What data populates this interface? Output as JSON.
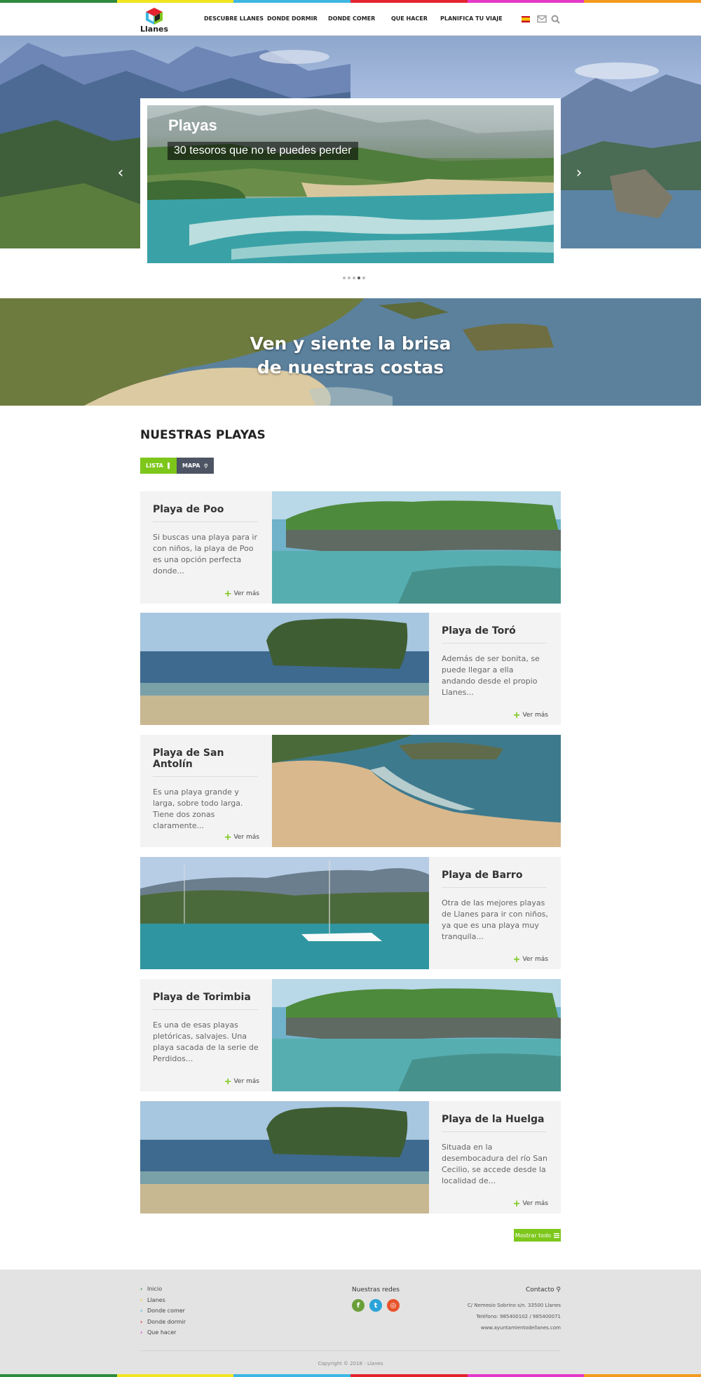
{
  "brand": {
    "logo_text": "Llanes"
  },
  "nav": {
    "items": [
      "DESCUBRE LLANES",
      "DONDE DORMIR",
      "DONDE COMER",
      "QUE HACER",
      "PLANIFICA TU VIAJE"
    ]
  },
  "colors": {
    "accent": "#7dc71b",
    "dark_button": "#4d5463",
    "bar": [
      "#2e8b3e",
      "#f2e51f",
      "#3cb6e3",
      "#e3232d",
      "#e438c8",
      "#f39a1e"
    ]
  },
  "slider": {
    "title": "Playas",
    "subtitle": "30 tesoros que no te puedes perder",
    "dots": 5,
    "active_dot": 4
  },
  "banner": {
    "line1": "Ven y siente la brisa",
    "line2": "de nuestras costas"
  },
  "section": {
    "title": "NUESTRAS PLAYAS",
    "list_label": "LISTA",
    "map_label": "MAPA"
  },
  "beaches": [
    {
      "name": "Playa de Poo",
      "text": "Si buscas una playa para ir con niños, la playa de Poo es una opción perfecta donde...",
      "more": "Ver más"
    },
    {
      "name": "Playa de Toró",
      "text": "Además de ser bonita, se puede llegar a ella andando desde el propio Llanes...",
      "more": "Ver más"
    },
    {
      "name": "Playa de San Antolín",
      "text": "Es una playa grande y larga, sobre todo larga. Tiene dos zonas claramente...",
      "more": "Ver más"
    },
    {
      "name": "Playa de Barro",
      "text": "Otra de las mejores playas de Llanes para ir con niños, ya que es una playa muy tranquila...",
      "more": "Ver más"
    },
    {
      "name": "Playa de Torimbia",
      "text": "Es una de esas playas pletóricas, salvajes. Una playa sacada de la serie de Perdidos...",
      "more": "Ver más"
    },
    {
      "name": "Playa de la Huelga",
      "text": "Situada en la desembocadura del río San Cecilio, se accede desde la localidad de...",
      "more": "Ver más"
    }
  ],
  "show_all": "Mostrar todo",
  "footer": {
    "links": [
      "Inicio",
      "Llanes",
      "Donde comer",
      "Donde dormir",
      "Que hacer"
    ],
    "link_colors": [
      "#2e8b3e",
      "#f2c51f",
      "#3cb6e3",
      "#e3232d",
      "#e438c8"
    ],
    "social_title": "Nuestras redes",
    "social": [
      {
        "icon": "facebook-icon",
        "label": "f",
        "color": "#6a9f3a"
      },
      {
        "icon": "twitter-icon",
        "label": "t",
        "color": "#2aa3d8"
      },
      {
        "icon": "instagram-icon",
        "label": "◎",
        "color": "#e8532a"
      }
    ],
    "contact_title": "Contacto",
    "contact_lines": [
      "C/ Nemesio Sobrino s/n. 33500 Llanes",
      "Teléfono: 985400102 / 985400071",
      "www.ayuntamientodellanes.com"
    ],
    "copyright": "Copyright © 2018 - Llanes"
  }
}
